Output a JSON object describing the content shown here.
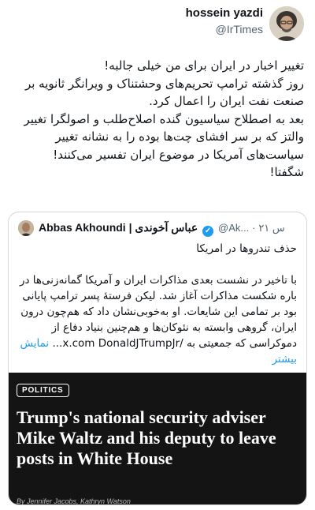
{
  "author": {
    "display_name": "hossein yazdi",
    "handle": "@IrTimes",
    "avatar_icon": "portrait-avatar-icon"
  },
  "tweet": {
    "lines": [
      "تغییر اخبار در ایران برای من خیلی جالبه!",
      "روز گذشته ترامپ تحریم‌های وحشتناک و ویرانگر ثانویه بر صنعت نفت ایران را اعمال کرد.",
      "بعد به اصطلاح سیاسیون گنده اصلاح‌طلب و اصولگرا تغییر والتز که بر سر افشای چت‌ها بوده را به نشانه تغییر سیاست‌های آمریکا در موضوع ایران تفسیر می‌کنند!",
      "شگفتا!"
    ]
  },
  "quote": {
    "author_name": "Abbas Akhoundi | عباس آخوندی",
    "verified_icon": "verified-badge-icon",
    "handle": "@Ak...",
    "time": "۲۱ س",
    "headline": "حذف تندروها در امریکا",
    "body": "با تاخیر در نشست بعدی مذاکرات ایران و آمریکا گمانه‌زنی‌ها در باره شکست مذاکرات آغاز شد. لیکن فرستهٔ پسر ترامپ پایانی بود بر تمامی این شایعات. او به‌خوبی‌نشان داد که هم‌چون درون ایران، گروهی وابسته به نئوکان‌ها و هم‌چنین بنیاد دفاع از دموکراسی که جمعیتی به /x.com",
    "body_end": "DonaldJTrumpJr...",
    "show_more": "نمایش بیشتر"
  },
  "article": {
    "tag": "POLITICS",
    "title": "Trump's national security adviser Mike Waltz and his deputy to leave posts in White House",
    "byline": "By Jennifer Jacobs, Kathryn Watson"
  }
}
